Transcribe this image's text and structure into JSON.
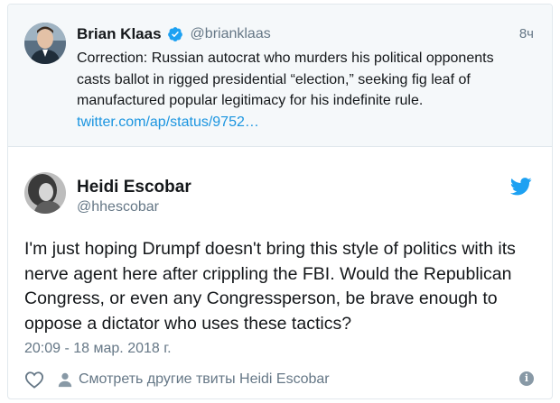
{
  "parent_tweet": {
    "author_name": "Brian Klaas",
    "author_handle": "@brianklaas",
    "time": "8ч",
    "text_lines": [
      "Correction: Russian autocrat who murders his political opponents",
      "casts ballot in rigged presidential “election,” seeking fig leaf of",
      "manufactured popular legitimacy for his indefinite rule."
    ],
    "link": "twitter.com/ap/status/9752…",
    "icons": {
      "verified": "verified-badge-icon"
    }
  },
  "tweet": {
    "author_name": "Heidi Escobar",
    "author_handle": "@hhescobar",
    "text_lines": [
      "I'm just hoping Drumpf doesn't bring this style of politics with its",
      "nerve agent here after crippling the FBI. Would the Republican",
      "Congress, or even any Congressperson, be brave enough to",
      "oppose a dictator who uses these tactics?"
    ],
    "date": "20:09 - 18 мар. 2018 г.",
    "more_tweets_label": "Смотреть другие твиты Heidi Escobar",
    "icons": {
      "logo": "twitter-bird-icon",
      "like": "heart-icon",
      "profile": "person-icon",
      "info": "info-icon"
    }
  },
  "colors": {
    "link": "#1b95e0",
    "secondary_text": "#657786",
    "twitter_blue": "#1da1f2",
    "parent_background": "#f5f8fa"
  }
}
